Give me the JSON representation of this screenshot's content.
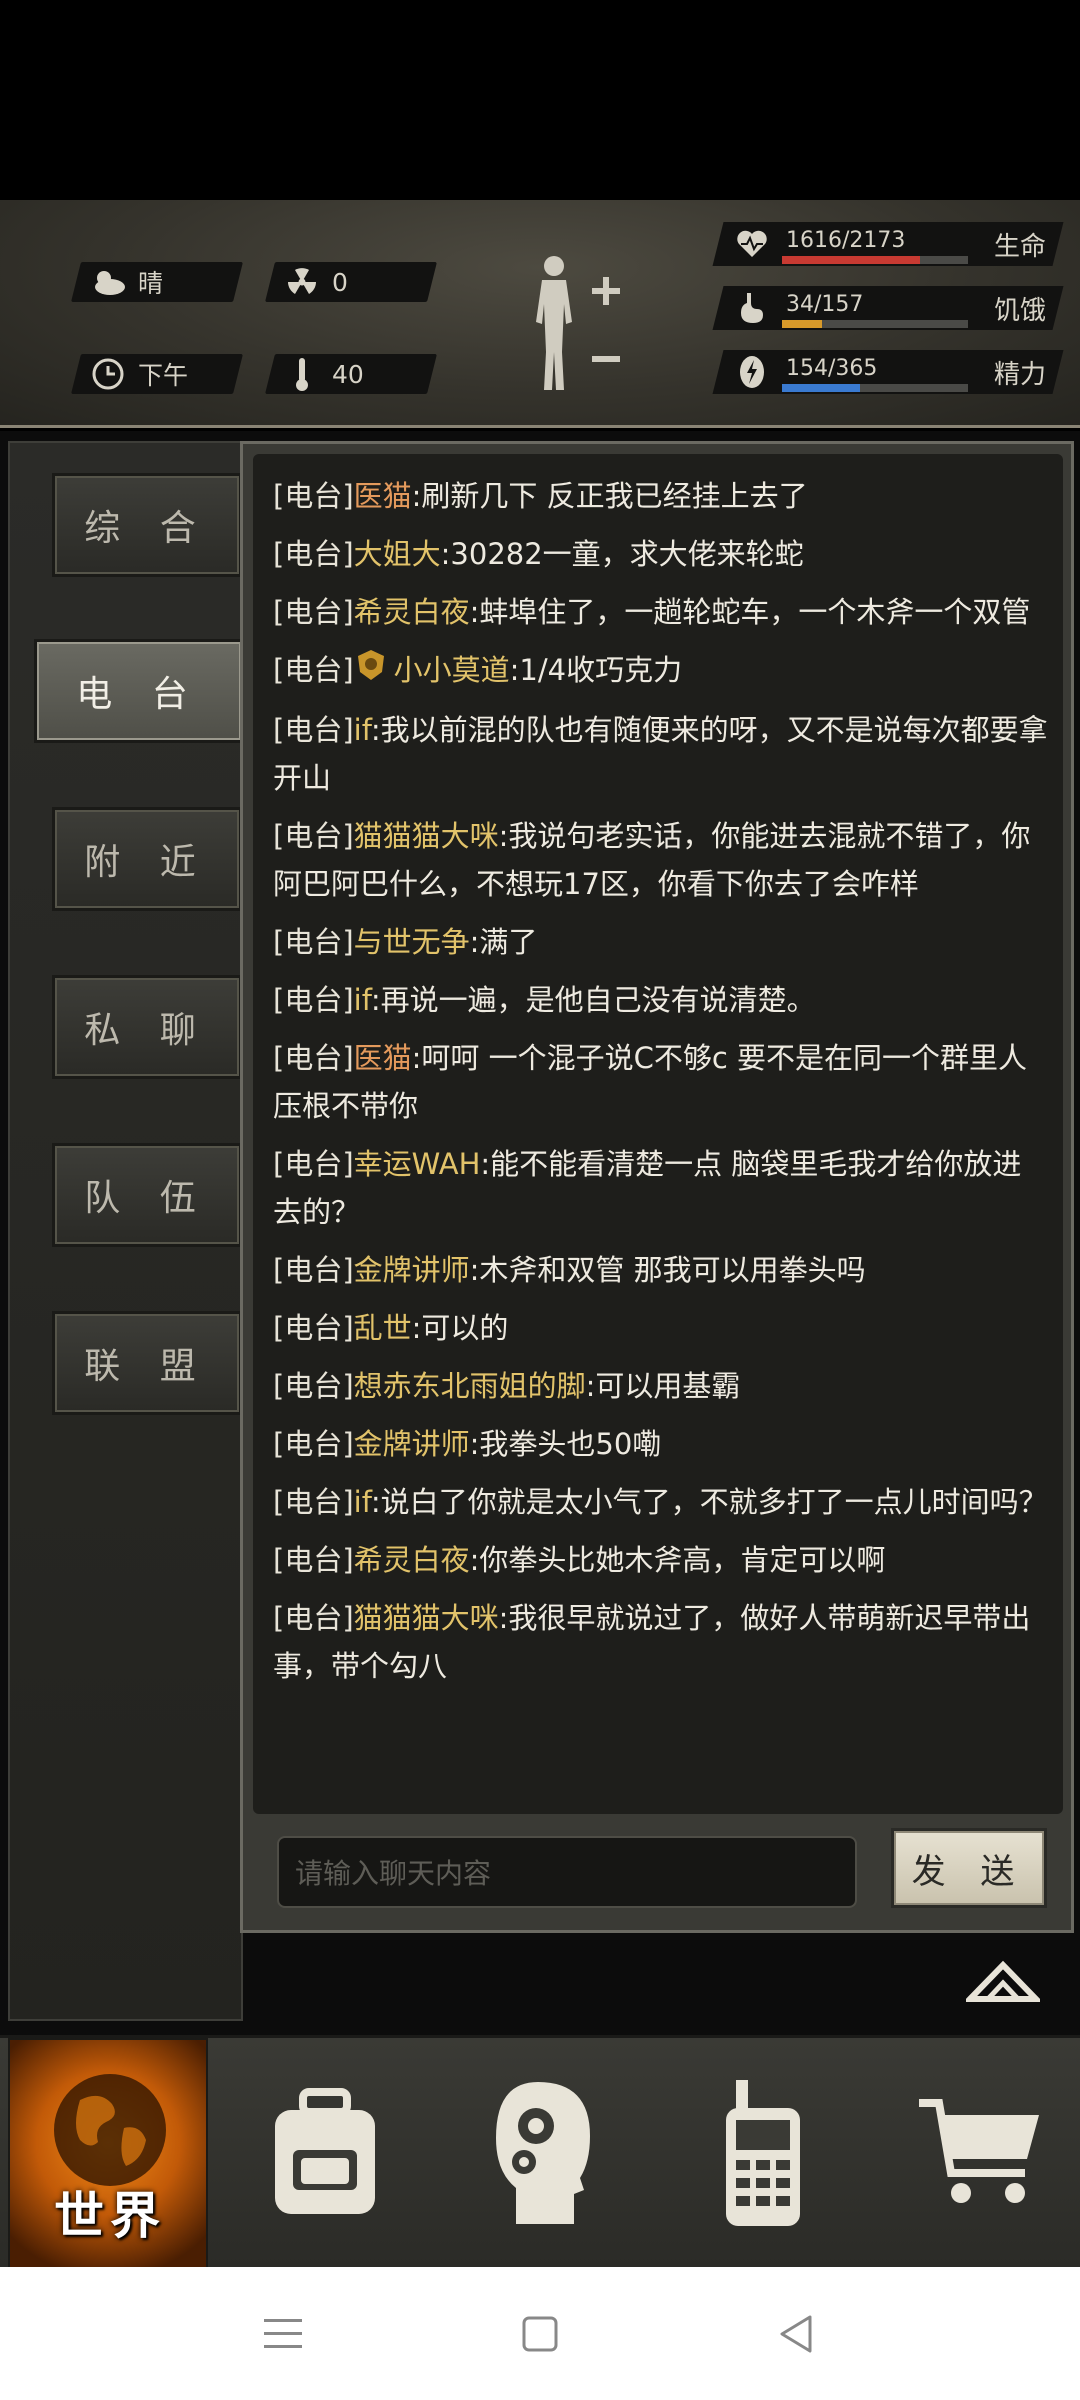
{
  "hud": {
    "weather": "晴",
    "radiation": "0",
    "time_of_day": "下午",
    "temperature": "40",
    "stats": [
      {
        "value": "1616/2173",
        "label": "生命",
        "fraction": 0.744,
        "color": "#c83a32",
        "icon": "heart-pulse-icon"
      },
      {
        "value": "34/157",
        "label": "饥饿",
        "fraction": 0.217,
        "color": "#d89a2a",
        "icon": "stomach-icon"
      },
      {
        "value": "154/365",
        "label": "精力",
        "fraction": 0.422,
        "color": "#3a7ad0",
        "icon": "energy-bolt-icon"
      }
    ]
  },
  "tabs": [
    "综 合",
    "电 台",
    "附 近",
    "私 聊",
    "队 伍",
    "联 盟"
  ],
  "active_tab": "电 台",
  "messages": [
    {
      "channel": "[电台]",
      "name": "医猫",
      "name_color": "orange",
      "text": ":刷新几下 反正我已经挂上去了"
    },
    {
      "channel": "[电台]",
      "name": "大姐大",
      "name_color": "gold",
      "text": ":30282一童，求大佬来轮蛇"
    },
    {
      "channel": "[电台]",
      "name": "希灵白夜",
      "name_color": "gold",
      "text": ":蚌埠住了，一趟轮蛇车，一个木斧一个双管"
    },
    {
      "channel": "[电台]",
      "name": "小小莫道",
      "name_color": "gold",
      "text": ":1/4收巧克力",
      "badge": true
    },
    {
      "channel": "[电台]",
      "name": "if",
      "name_color": "gold",
      "text": ":我以前混的队也有随便来的呀，又不是说每次都要拿开山"
    },
    {
      "channel": "[电台]",
      "name": "猫猫猫大咪",
      "name_color": "gold",
      "text": ":我说句老实话，你能进去混就不错了，你阿巴阿巴什么，不想玩17区，你看下你去了会咋样"
    },
    {
      "channel": "[电台]",
      "name": "与世无争",
      "name_color": "gold",
      "text": ":满了"
    },
    {
      "channel": "[电台]",
      "name": "if",
      "name_color": "gold",
      "text": ":再说一遍，是他自己没有说清楚。"
    },
    {
      "channel": "[电台]",
      "name": "医猫",
      "name_color": "orange",
      "text": ":呵呵 一个混子说C不够c 要不是在同一个群里人压根不带你"
    },
    {
      "channel": "[电台]",
      "name": "幸运WAH",
      "name_color": "gold",
      "text": ":能不能看清楚一点 脑袋里毛我才给你放进去的？"
    },
    {
      "channel": "[电台]",
      "name": "金牌讲师",
      "name_color": "gold",
      "text": ":木斧和双管 那我可以用拳头吗"
    },
    {
      "channel": "[电台]",
      "name": "乱世",
      "name_color": "gold",
      "text": ":可以的"
    },
    {
      "channel": "[电台]",
      "name": "想赤东北雨姐的脚",
      "name_color": "gold",
      "text": ":可以用基霸"
    },
    {
      "channel": "[电台]",
      "name": "金牌讲师",
      "name_color": "gold",
      "text": ":我拳头也50嘞"
    },
    {
      "channel": "[电台]",
      "name": "if",
      "name_color": "gold",
      "text": ":说白了你就是太小气了，不就多打了一点儿时间吗？"
    },
    {
      "channel": "[电台]",
      "name": "希灵白夜",
      "name_color": "gold",
      "text": ":你拳头比她木斧高，肯定可以啊"
    },
    {
      "channel": "[电台]",
      "name": "猫猫猫大咪",
      "name_color": "gold",
      "text": ":我很早就说过了，做好人带萌新迟早带出事，带个勾八"
    }
  ],
  "chat_input": {
    "placeholder": "请输入聊天内容"
  },
  "send_label": "发 送",
  "bottom_nav": {
    "world_label": "世界",
    "items": [
      "backpack-icon",
      "skills-head-icon",
      "radio-walkie-icon",
      "shop-cart-icon"
    ]
  }
}
